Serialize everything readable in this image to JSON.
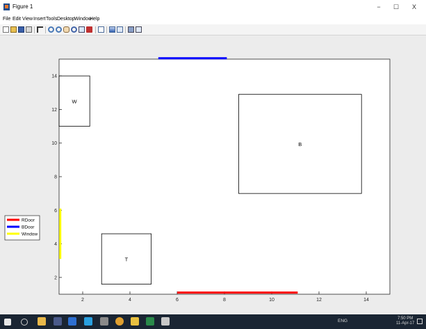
{
  "window": {
    "title": "Figure 1",
    "controls": {
      "minimize": "−",
      "maximize": "☐",
      "close": "X"
    }
  },
  "menubar": {
    "items": [
      "File",
      "Edit",
      "View",
      "Insert",
      "Tools",
      "Desktop",
      "Window",
      "Help"
    ]
  },
  "toolbar": {
    "buttons": [
      "new-figure-icon",
      "open-file-icon",
      "save-figure-icon",
      "print-figure-icon",
      "edit-plot-icon",
      "zoom-in-icon",
      "zoom-out-icon",
      "pan-icon",
      "rotate-3d-icon",
      "data-cursor-icon",
      "brush-icon",
      "link-plot-icon",
      "insert-colorbar-icon",
      "insert-legend-icon",
      "hide-plot-tools-icon",
      "show-plot-tools-icon"
    ]
  },
  "chart_data": {
    "type": "scatter",
    "title": "",
    "xlabel": "",
    "ylabel": "",
    "xlim": [
      1,
      15
    ],
    "ylim": [
      1,
      15
    ],
    "xticks": [
      2,
      4,
      6,
      8,
      10,
      12,
      14
    ],
    "yticks": [
      2,
      4,
      6,
      8,
      10,
      12,
      14
    ],
    "rectangles": [
      {
        "label": "W",
        "x": 1,
        "y": 11,
        "width": 1.3,
        "height": 3
      },
      {
        "label": "B",
        "x": 8.6,
        "y": 7,
        "width": 5.2,
        "height": 5.9
      },
      {
        "label": "T",
        "x": 2.8,
        "y": 1.6,
        "width": 2.1,
        "height": 3
      }
    ],
    "series": [
      {
        "name": "RDoor",
        "color": "#ff0000",
        "x": [
          6,
          11.1
        ],
        "y": [
          1.1,
          1.1
        ]
      },
      {
        "name": "BDoor",
        "color": "#0000ff",
        "x": [
          5.2,
          8.1
        ],
        "y": [
          15.05,
          15.05
        ]
      },
      {
        "name": "Window",
        "color": "#ffff00",
        "x": [
          1.05,
          1.05
        ],
        "y": [
          3.1,
          6.1
        ]
      }
    ],
    "legend_position": "outside-left",
    "grid": false
  },
  "taskbar": {
    "icons": [
      "start-icon",
      "task-view-icon",
      "file-explorer-icon",
      "matlab-icon",
      "app-icon-2",
      "app-icon-3",
      "app-icon-4",
      "chrome-icon",
      "app-icon-6",
      "excel-icon",
      "calculator-icon"
    ],
    "tray_language": "ENG",
    "clock_time": "7:50 PM",
    "clock_date": "11-Apr-17"
  }
}
